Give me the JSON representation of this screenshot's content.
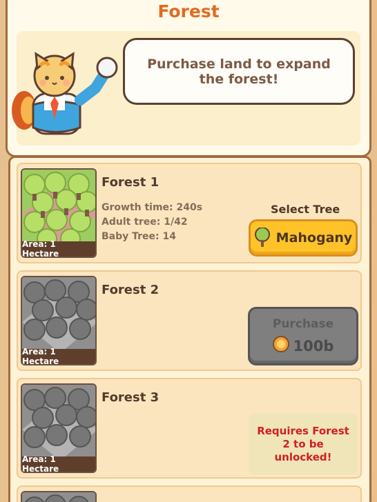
{
  "header": {
    "title": "Forest"
  },
  "intro": {
    "message": "Purchase land to expand the forest!"
  },
  "forests": [
    {
      "title": "Forest 1",
      "area": "Area: 1 Hectare",
      "growth_time": "Growth time: 240s",
      "adult_tree": "Adult tree: 1/42",
      "baby_tree": "Baby Tree: 14",
      "select_label": "Select Tree",
      "tree_button": "Mahogany"
    },
    {
      "title": "Forest 2",
      "area": "Area: 1 Hectare",
      "purchase_label": "Purchase",
      "price": "100b"
    },
    {
      "title": "Forest 3",
      "area": "Area: 1 Hectare",
      "lock_text": "Requires Forest 2 to be unlocked!"
    }
  ],
  "colors": {
    "title": "#e06b23",
    "panel": "#fffaea",
    "accent": "#ffc329",
    "warning": "#d11e1e"
  }
}
